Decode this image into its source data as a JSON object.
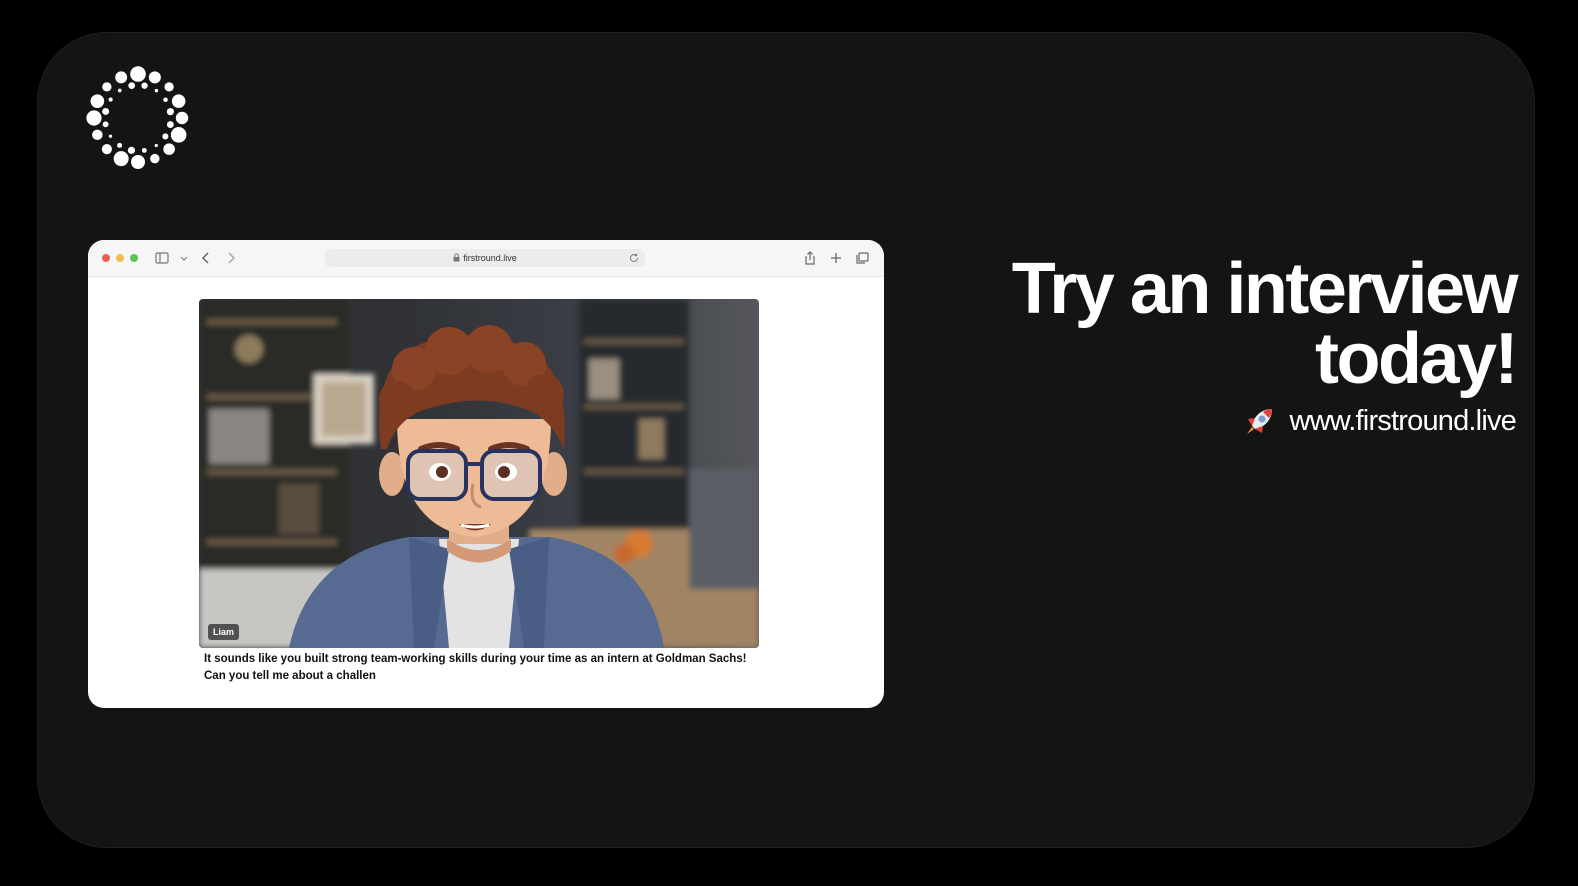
{
  "logo": {
    "icon": "dotted-ring-logo-icon"
  },
  "browser": {
    "url": "firstround.live",
    "video": {
      "speaker_name": "Liam"
    },
    "caption": "It sounds like you built strong team-working skills during your time as an intern at Goldman Sachs! Can you tell me about a challen"
  },
  "headline": {
    "line1": "Try an interview",
    "line2": "today!"
  },
  "website": {
    "icon": "rocket-icon",
    "text": "www.firstround.live"
  },
  "colors": {
    "page_bg": "#000000",
    "card_bg": "#141414",
    "text": "#ffffff"
  }
}
